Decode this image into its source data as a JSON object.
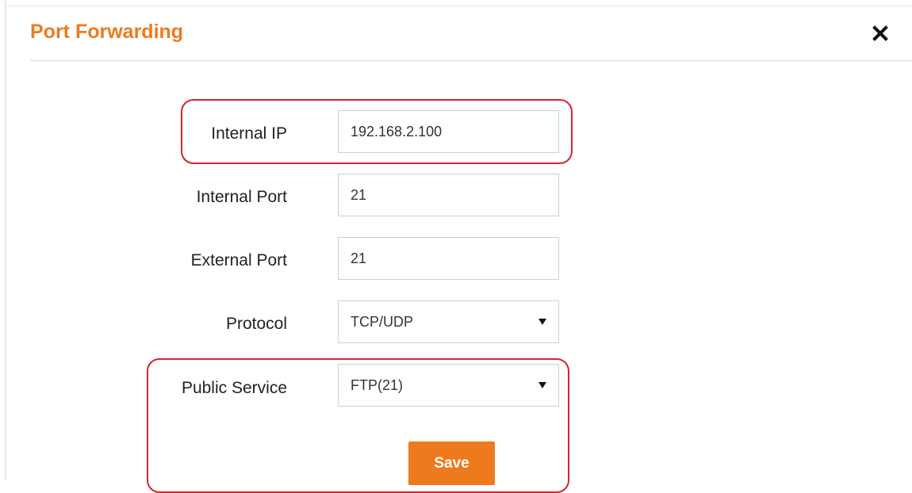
{
  "dialog": {
    "title": "Port Forwarding",
    "close_icon": "close-icon"
  },
  "form": {
    "internal_ip": {
      "label": "Internal IP",
      "value": "192.168.2.100"
    },
    "internal_port": {
      "label": "Internal Port",
      "value": "21"
    },
    "external_port": {
      "label": "External Port",
      "value": "21"
    },
    "protocol": {
      "label": "Protocol",
      "value": "TCP/UDP"
    },
    "public_service": {
      "label": "Public Service",
      "value": "FTP(21)"
    },
    "save_label": "Save"
  },
  "colors": {
    "accent": "#ee7a1e",
    "highlight": "#d8232a"
  }
}
